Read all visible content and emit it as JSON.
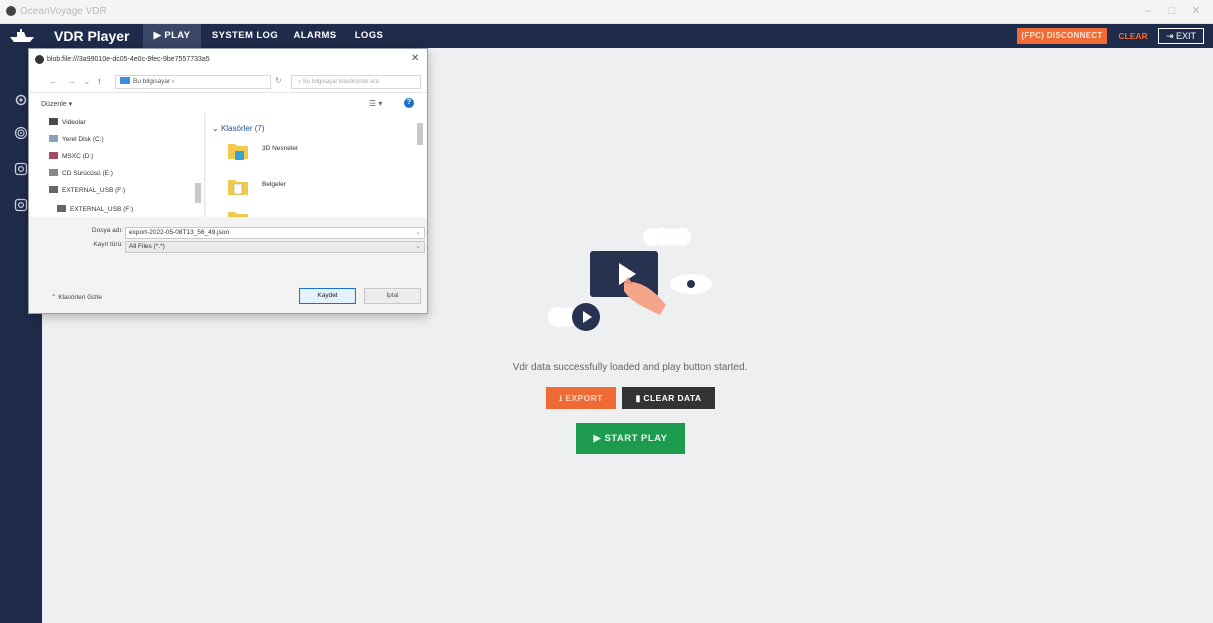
{
  "window": {
    "title": "OceanVoyage VDR",
    "controls": [
      "–",
      "□",
      "✕"
    ]
  },
  "navbar": {
    "brand": "VDR Player",
    "tabs": [
      {
        "label": "▶ PLAY",
        "active": true
      },
      {
        "label": "SYSTEM LOG",
        "active": false
      },
      {
        "label": "ALARMS",
        "active": false
      },
      {
        "label": "LOGS",
        "active": false
      }
    ],
    "fpc_disconnect": "(FPC) DISCONNECT",
    "clear": "CLEAR",
    "exit": "EXIT"
  },
  "sidebar": {
    "icons": [
      "gear-icon",
      "fingerprint-icon",
      "camera-icon",
      "camera-icon"
    ]
  },
  "main": {
    "message": "Vdr data successfully loaded and play button started.",
    "export_label": "EXPORT",
    "clear_data_label": "CLEAR DATA",
    "start_play_label": "START PLAY"
  },
  "dialog": {
    "url": "blob:file:///3a99010e-dc05-4e0c-9fec-9be7557733a5",
    "close": "✕",
    "path_label": "Bu bilgisayar",
    "search_placeholder": "Bu bilgisayar klasöründe ara",
    "organize": "Düzenle ▾",
    "tree": [
      {
        "label": "Videolar",
        "icon": "video-folder-icon"
      },
      {
        "label": "Yerel Disk (C:)",
        "icon": "drive-icon"
      },
      {
        "label": "MSXC (D:)",
        "icon": "drive-icon"
      },
      {
        "label": "CD Sürücüsü (E:)",
        "icon": "cd-drive-icon"
      },
      {
        "label": "EXTERNAL_USB (F:)",
        "icon": "usb-drive-icon"
      },
      {
        "label": "EXTERNAL_USB (F:)",
        "icon": "usb-drive-icon"
      }
    ],
    "folder_group": "Klasörler (7)",
    "folders": [
      {
        "label": "3D Nesneler"
      },
      {
        "label": "Belgeler"
      }
    ],
    "filename_label": "Dosya adı:",
    "filename_value": "export-2022-05-08T13_56_49.json",
    "filetype_label": "Kayıt türü:",
    "filetype_value": "All Files (*.*)",
    "hide_folders": "Klasörleri Gizle",
    "save_label": "Kaydet",
    "cancel_label": "İptal"
  }
}
